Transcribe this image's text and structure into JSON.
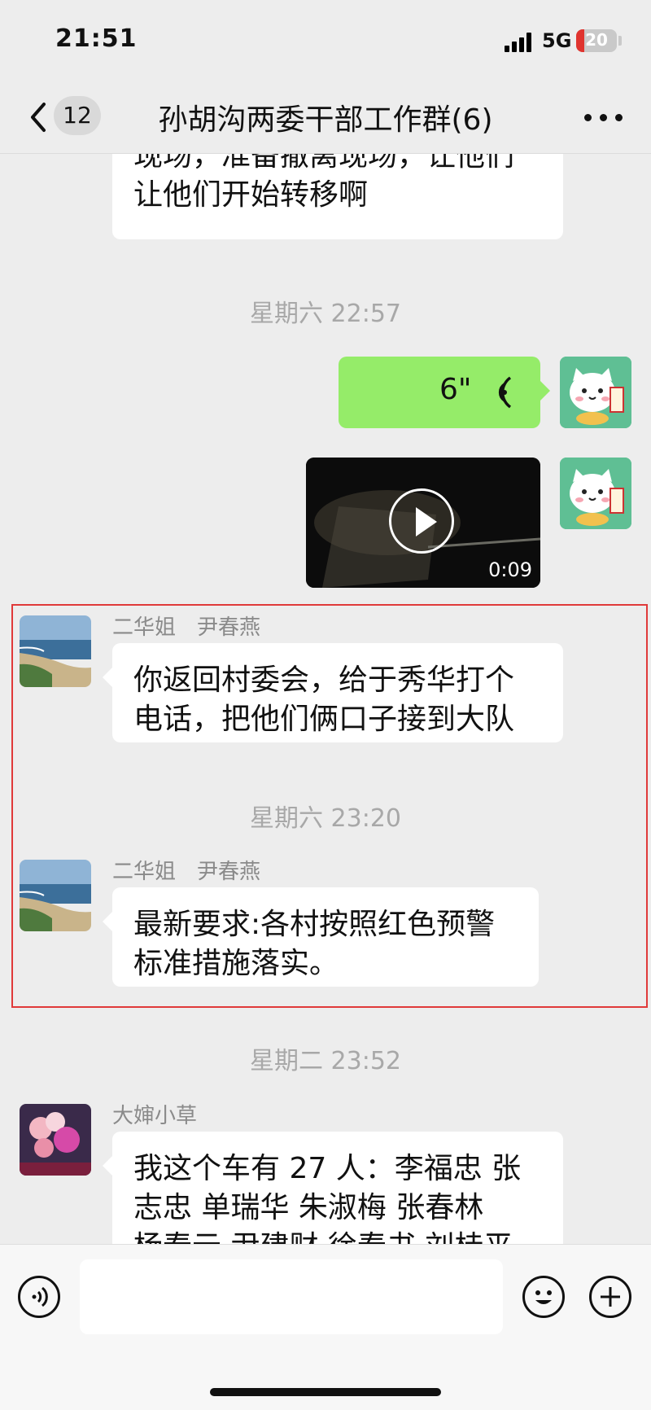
{
  "status_bar": {
    "time": "21:51",
    "network": "5G",
    "battery": "20",
    "battery_level": 0.2,
    "battery_color": "#e0342f"
  },
  "header": {
    "unread_count": "12",
    "title": "孙胡沟两委干部工作群(6)",
    "back_icon": "chevron-left-icon",
    "more_icon": "more-dots-icon"
  },
  "colors": {
    "background": "#ededed",
    "outgoing_bubble": "#95ec69",
    "incoming_bubble": "#ffffff",
    "selection_border": "#e03a3a",
    "timestamp": "#a8a8a8"
  },
  "messages": {
    "m0": {
      "lines": [
        "现场，准备撤离现场，让他们",
        "让他们开始转移啊"
      ]
    },
    "t1": "星期六 22:57",
    "voice": {
      "duration": "6\"",
      "icon": "voice-wave-icon"
    },
    "video": {
      "duration": "0:09",
      "icon": "play-icon"
    },
    "m3": {
      "sender": "二华姐",
      "alias": "尹春燕",
      "lines": [
        "你返回村委会，给于秀华打个",
        "电话，把他们俩口子接到大队"
      ]
    },
    "t2": "星期六 23:20",
    "m4": {
      "sender": "二华姐",
      "alias": "尹春燕",
      "lines": [
        "最新要求:各村按照红色预警",
        "标准措施落实。"
      ]
    },
    "t3": "星期二 23:52",
    "m5": {
      "sender": "大婶小草",
      "lines": [
        "我这个车有 27 人：李福忠  张",
        "志忠 单瑞华   朱淑梅  张春林",
        "杨春云  尹建财 徐春书 刘桂平"
      ]
    }
  },
  "input_bar": {
    "voice_icon": "voice-input-icon",
    "emoji_icon": "emoji-icon",
    "plus_icon": "plus-icon",
    "placeholder": ""
  }
}
